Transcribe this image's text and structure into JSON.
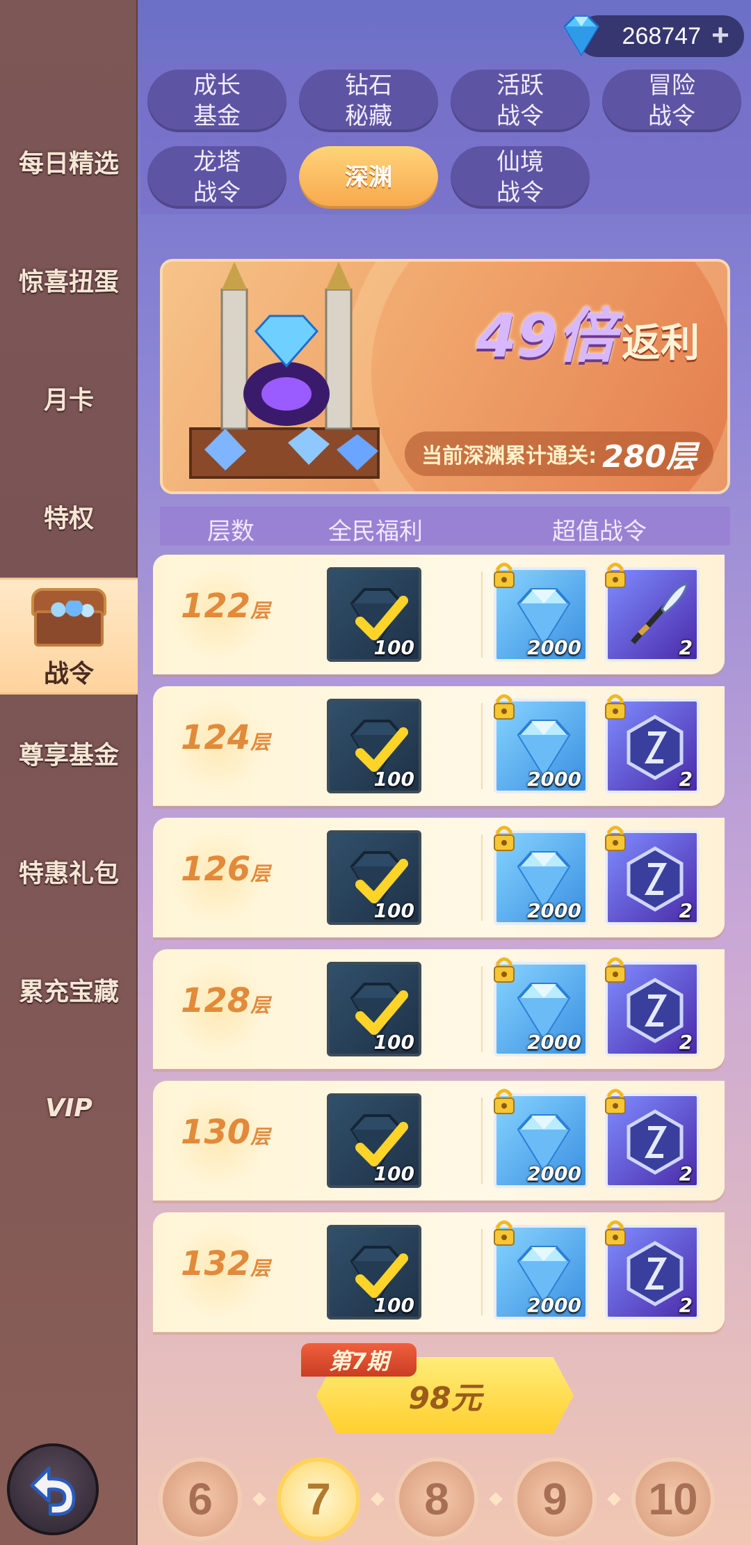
{
  "currency": {
    "amount": "268747",
    "icon": "diamond-icon",
    "add_icon": "plus-icon"
  },
  "sidebar": {
    "items": [
      {
        "label": "每日精选"
      },
      {
        "label": "惊喜扭蛋"
      },
      {
        "label": "月卡"
      },
      {
        "label": "特权"
      },
      {
        "label": "战令",
        "active": true,
        "icon": "treasure-chest-icon"
      },
      {
        "label": "尊享基金"
      },
      {
        "label": "特惠礼包"
      },
      {
        "label": "累充宝藏"
      },
      {
        "label": "VIP"
      }
    ]
  },
  "tabs": [
    {
      "label": "成长\n基金"
    },
    {
      "label": "钻石\n秘藏"
    },
    {
      "label": "活跃\n战令"
    },
    {
      "label": "冒险\n战令"
    },
    {
      "label": "龙塔\n战令"
    },
    {
      "label": "深渊",
      "active": true
    },
    {
      "label": "仙境\n战令"
    }
  ],
  "banner": {
    "multiplier": "49倍",
    "rebate": "返利",
    "progress_label": "当前深渊累计通关:",
    "progress_value": "280层"
  },
  "columns": {
    "floor": "层数",
    "free": "全民福利",
    "premium": "超值战令"
  },
  "rows": [
    {
      "floor": "122",
      "unit": "层",
      "free_qty": "100",
      "gem_qty": "2000",
      "item_qty": "2",
      "item_icon": "quill-sword-icon"
    },
    {
      "floor": "124",
      "unit": "层",
      "free_qty": "100",
      "gem_qty": "2000",
      "item_qty": "2",
      "item_icon": "rune-stone-icon"
    },
    {
      "floor": "126",
      "unit": "层",
      "free_qty": "100",
      "gem_qty": "2000",
      "item_qty": "2",
      "item_icon": "rune-stone-icon"
    },
    {
      "floor": "128",
      "unit": "层",
      "free_qty": "100",
      "gem_qty": "2000",
      "item_qty": "2",
      "item_icon": "rune-stone-icon"
    },
    {
      "floor": "130",
      "unit": "层",
      "free_qty": "100",
      "gem_qty": "2000",
      "item_qty": "2",
      "item_icon": "rune-stone-icon"
    },
    {
      "floor": "132",
      "unit": "层",
      "free_qty": "100",
      "gem_qty": "2000",
      "item_qty": "2",
      "item_icon": "rune-stone-icon"
    }
  ],
  "purchase": {
    "period_tag": "第7期",
    "price": "98元"
  },
  "periods": [
    {
      "label": "6"
    },
    {
      "label": "7",
      "active": true
    },
    {
      "label": "8"
    },
    {
      "label": "9"
    },
    {
      "label": "10"
    }
  ],
  "colors": {
    "accent": "#f7a84b",
    "sidebar": "#7d5656",
    "tab": "#5e54a4"
  }
}
